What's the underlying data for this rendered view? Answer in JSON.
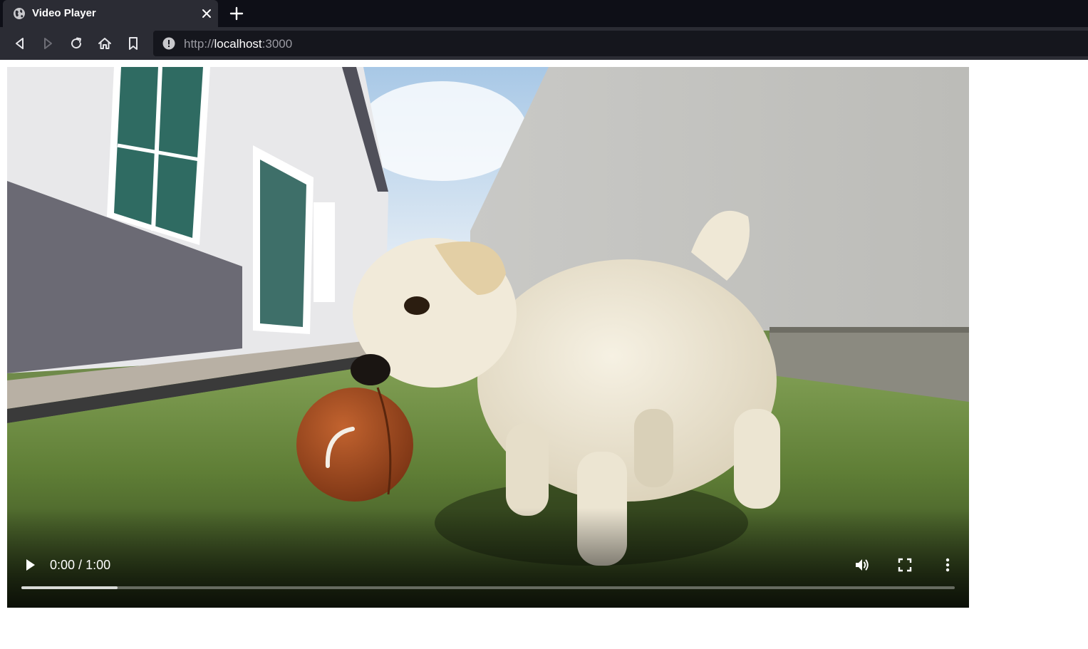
{
  "browser": {
    "tab": {
      "title": "Video Player",
      "favicon": "globe-icon"
    },
    "new_tab_icon": "plus-icon",
    "toolbar": {
      "back_icon": "back-icon",
      "forward_icon": "forward-icon",
      "reload_icon": "reload-icon",
      "home_icon": "home-icon",
      "bookmark_icon": "bookmark-icon"
    },
    "url": {
      "scheme": "http://",
      "host": "localhost",
      "port": ":3000",
      "info_icon": "info-icon"
    }
  },
  "video": {
    "current_time": "0:00",
    "separator": " / ",
    "duration": "1:00",
    "buffered_fraction": 0.103,
    "icons": [
      "play-icon",
      "volume-icon",
      "fullscreen-icon",
      "more-options-icon"
    ]
  },
  "colors": {
    "tabstrip_bg": "#0e0f17",
    "toolbar_bg": "#2b2c34",
    "urlbar_bg": "#15161d",
    "text_white": "#ffffff",
    "text_muted": "#9a9aa2"
  }
}
